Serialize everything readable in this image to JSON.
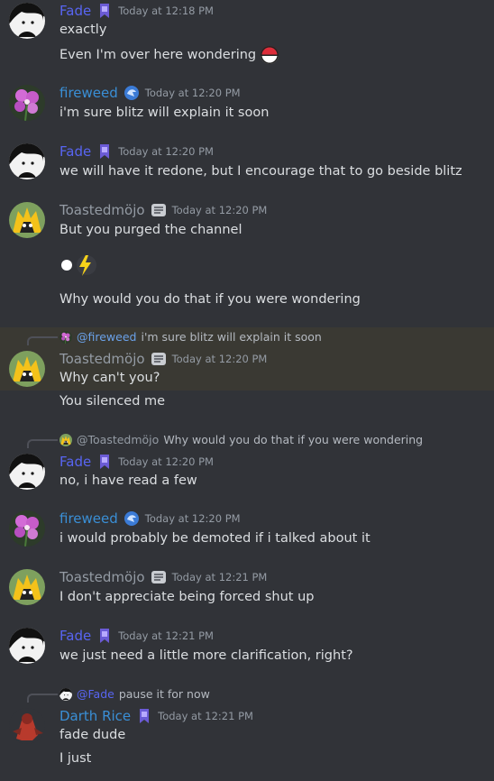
{
  "colors": {
    "fade": "#5865f2",
    "fireweed": "#3a8fd6",
    "toasted": "#949ba4",
    "darth": "#3a8fd6"
  },
  "users": {
    "fade": "Fade",
    "fireweed": "fireweed",
    "toasted": "Toastedmöjo",
    "darth": "Darth Rice"
  },
  "messages": {
    "m1": {
      "ts": "Today at 12:18 PM",
      "line1": "exactly",
      "line2": "Even I'm over here wondering"
    },
    "m2": {
      "ts": "Today at 12:20 PM",
      "line1": "i'm sure blitz will explain it soon"
    },
    "m3": {
      "ts": "Today at 12:20 PM",
      "line1": "we will have it redone, but I encourage that to go beside blitz"
    },
    "m4": {
      "ts": "Today at 12:20 PM",
      "line1": "But you purged the channel",
      "line3": "Why would you do that if you were wondering"
    },
    "m5": {
      "reply_mention": "@fireweed",
      "reply_text": "i'm sure blitz will explain it soon",
      "ts": "Today at 12:20 PM",
      "line1": "Why can't you?",
      "line2": "You silenced me"
    },
    "m6": {
      "reply_mention": "@Toastedmöjo",
      "reply_text": "Why would you do that if you were wondering",
      "ts": "Today at 12:20 PM",
      "line1": "no, i have read a few"
    },
    "m7": {
      "ts": "Today at 12:20 PM",
      "line1": "i would probably be demoted if i talked about it"
    },
    "m8": {
      "ts": "Today at 12:21 PM",
      "line1": "I don't appreciate being forced shut up"
    },
    "m9": {
      "ts": "Today at 12:21 PM",
      "line1": "we just need a little more clarification, right?"
    },
    "m10": {
      "reply_mention": "@Fade",
      "reply_text": "pause it for now",
      "ts": "Today at 12:21 PM",
      "line1": "fade dude",
      "line2": "I just"
    }
  },
  "icons": {
    "fade_avatar": "black-hair-character-avatar",
    "fireweed_avatar": "pink-flower-avatar",
    "toasted_avatar": "yellow-black-character-avatar",
    "darth_avatar": "red-armored-character-avatar",
    "pokeball_emoji": "pokeball-emoji",
    "lightning_sticker": "lightning-bolt-emoji"
  }
}
